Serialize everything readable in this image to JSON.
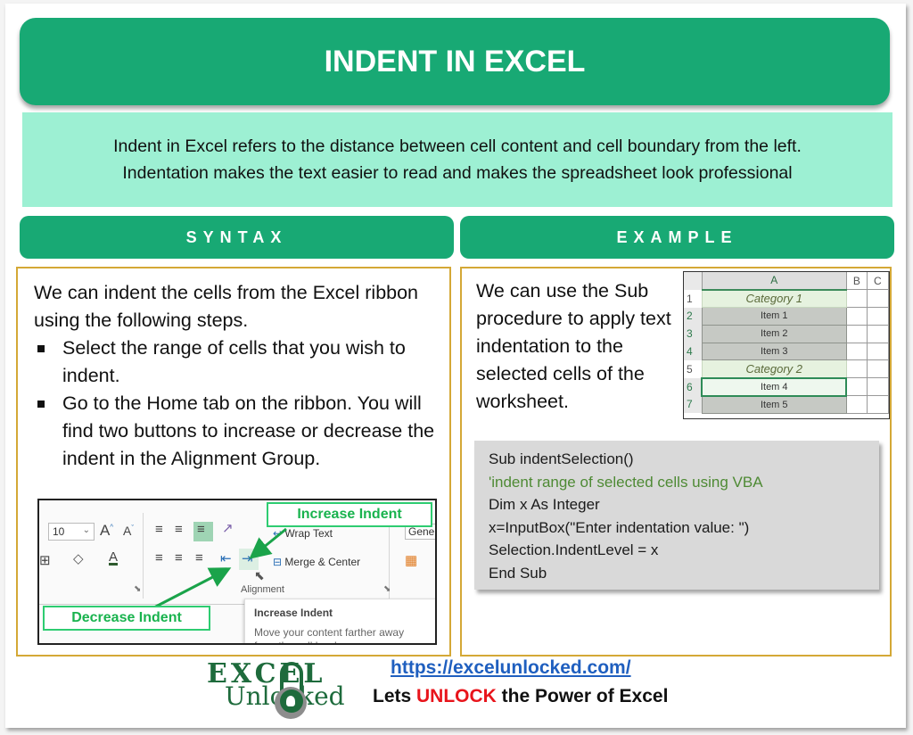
{
  "title": "INDENT IN EXCEL",
  "intro": {
    "line1": "Indent in Excel refers to the distance between cell content and cell boundary from the left.",
    "line2": "Indentation makes the text easier to read and makes the spreadsheet look professional"
  },
  "syntax": {
    "heading": "SYNTAX",
    "paragraph": "We can indent the cells from the Excel ribbon using the following steps.",
    "bullets": [
      "Select the range of cells that you wish to indent.",
      "Go to the Home tab on the ribbon. You will find two buttons to increase or decrease the indent in the Alignment Group."
    ],
    "ribbon": {
      "font_size_value": "10",
      "wrap_text": "Wrap Text",
      "merge_center": "Merge & Center",
      "number_format": "Gener",
      "group_label": "Alignment",
      "callout_increase": "Increase Indent",
      "callout_decrease": "Decrease Indent",
      "tooltip_title": "Increase Indent",
      "tooltip_body": "Move your content farther away from the cell border"
    }
  },
  "example": {
    "heading": "EXAMPLE",
    "paragraph": "We can use the Sub procedure to apply text indentation to the selected cells of the worksheet.",
    "sheet": {
      "columns": [
        "A",
        "B",
        "C"
      ],
      "rows": [
        {
          "num": "1",
          "a": "Category 1",
          "type": "cat"
        },
        {
          "num": "2",
          "a": "Item 1",
          "type": "item"
        },
        {
          "num": "3",
          "a": "Item 2",
          "type": "item"
        },
        {
          "num": "4",
          "a": "Item 3",
          "type": "item"
        },
        {
          "num": "5",
          "a": "Category 2",
          "type": "cat"
        },
        {
          "num": "6",
          "a": "Item 4",
          "type": "active"
        },
        {
          "num": "7",
          "a": "Item 5",
          "type": "item"
        }
      ]
    },
    "code": [
      {
        "text": "Sub indentSelection()",
        "comment": false
      },
      {
        "text": "'indent range of selected cells using VBA",
        "comment": true
      },
      {
        "text": "Dim x As Integer",
        "comment": false
      },
      {
        "text": "x=InputBox(\"Enter indentation value: \")",
        "comment": false
      },
      {
        "text": "Selection.IndentLevel = x",
        "comment": false
      },
      {
        "text": "End Sub",
        "comment": false
      }
    ]
  },
  "footer": {
    "logo_top": "EXCEL",
    "logo_bottom": "Unlocked",
    "url": "https://excelunlocked.com/",
    "tagline_before": "Lets ",
    "tagline_highlight": "UNLOCK",
    "tagline_after": " the Power of Excel"
  },
  "colors": {
    "primary_green": "#18a974",
    "intro_bg": "#9df0d3",
    "panel_border": "#d4a836",
    "comment_green": "#4e8a34",
    "link_blue": "#1f5fbf",
    "highlight_red": "#e8141b"
  }
}
